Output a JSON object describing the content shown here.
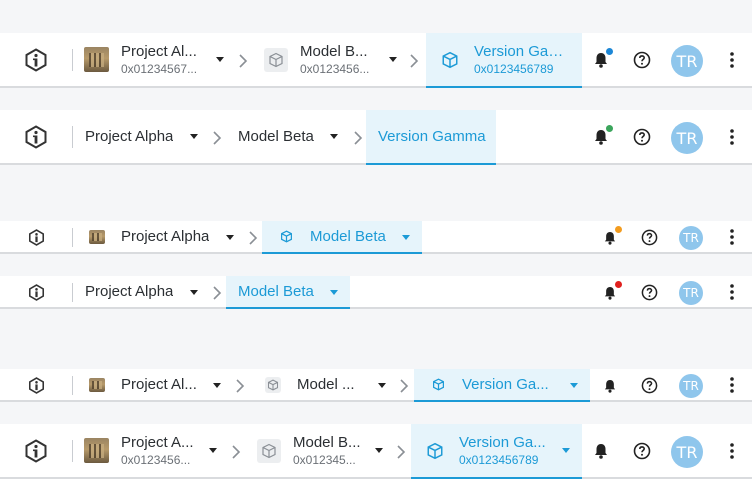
{
  "colors": {
    "accent": "#1c9ad6",
    "active_bg": "#e6f4fb",
    "avatar_bg": "#8fc6ec",
    "dot_blue": "#1c87d6",
    "dot_green": "#3ba55c",
    "dot_orange": "#f39c1f",
    "dot_red": "#e0201e"
  },
  "icons": {
    "logo": "info-logo-icon",
    "project": "project-thumbnail",
    "model": "cube-icon",
    "version": "cube-icon",
    "separator": "chevron-right-icon",
    "dropdown": "caret-down-icon",
    "notifications": "bell-icon",
    "help": "question-circle-icon",
    "more": "more-vertical-icon"
  },
  "header_1": {
    "project": {
      "name": "Project Al...",
      "id": "0x01234567..."
    },
    "model": {
      "name": "Model B...",
      "id": "0x0123456..."
    },
    "version": {
      "name": "Version Gam...",
      "id": "0x0123456789"
    },
    "avatar": "TR",
    "notification_dot": "blue"
  },
  "header_2": {
    "project": {
      "name": "Project Alpha"
    },
    "model": {
      "name": "Model Beta"
    },
    "version": {
      "name": "Version Gamma"
    },
    "avatar": "TR",
    "notification_dot": "green"
  },
  "header_3": {
    "project": {
      "name": "Project Alpha"
    },
    "model": {
      "name": "Model Beta"
    },
    "avatar": "TR",
    "notification_dot": "orange"
  },
  "header_4": {
    "project": {
      "name": "Project Alpha"
    },
    "model": {
      "name": "Model Beta"
    },
    "avatar": "TR",
    "notification_dot": "red"
  },
  "header_5": {
    "project": {
      "name": "Project Al..."
    },
    "model": {
      "name": "Model ..."
    },
    "version": {
      "name": "Version Ga..."
    },
    "avatar": "TR"
  },
  "header_6": {
    "project": {
      "name": "Project A...",
      "id": "0x0123456..."
    },
    "model": {
      "name": "Model B...",
      "id": "0x012345..."
    },
    "version": {
      "name": "Version Ga...",
      "id": "0x0123456789"
    },
    "avatar": "TR"
  }
}
